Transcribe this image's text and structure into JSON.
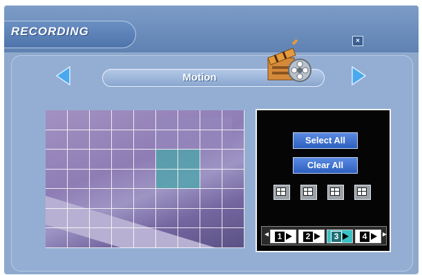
{
  "window": {
    "title": "RECORDING",
    "close_label": "×"
  },
  "mode_selector": {
    "value": "Motion",
    "prev_icon": "triangle-left",
    "next_icon": "triangle-right"
  },
  "motion_grid": {
    "columns": 9,
    "rows": 7,
    "active_cells": [
      [
        2,
        5
      ],
      [
        2,
        6
      ],
      [
        3,
        5
      ],
      [
        3,
        6
      ]
    ]
  },
  "controls": {
    "select_all_label": "Select All",
    "clear_all_label": "Clear All",
    "split_buttons": [
      "split-view-1",
      "split-view-2",
      "split-view-3",
      "split-view-4"
    ],
    "cameras": [
      "1",
      "2",
      "3",
      "4"
    ],
    "selected_camera": "3"
  },
  "colors": {
    "accent": "#4b9cff",
    "selected_camera": "#39c2c6",
    "active_cell": "#49a6aa"
  }
}
